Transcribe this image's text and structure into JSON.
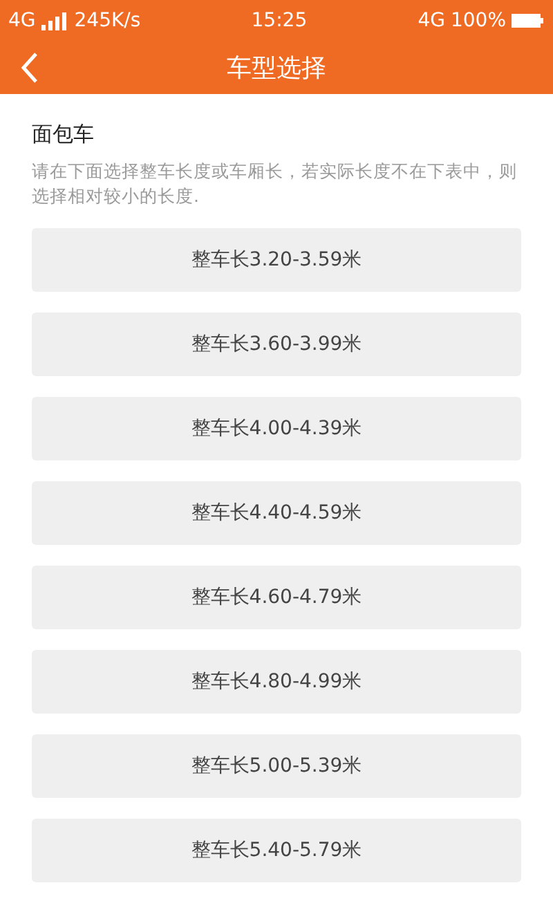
{
  "status_bar": {
    "network": "4G",
    "speed": "245K/s",
    "time": "15:25",
    "network_right": "4G",
    "battery": "100%"
  },
  "nav": {
    "title": "车型选择"
  },
  "section": {
    "title": "面包车",
    "description": "请在下面选择整车长度或车厢长，若实际长度不在下表中，则选择相对较小的长度."
  },
  "options": [
    "整车长3.20-3.59米",
    "整车长3.60-3.99米",
    "整车长4.00-4.39米",
    "整车长4.40-4.59米",
    "整车长4.60-4.79米",
    "整车长4.80-4.99米",
    "整车长5.00-5.39米",
    "整车长5.40-5.79米"
  ]
}
